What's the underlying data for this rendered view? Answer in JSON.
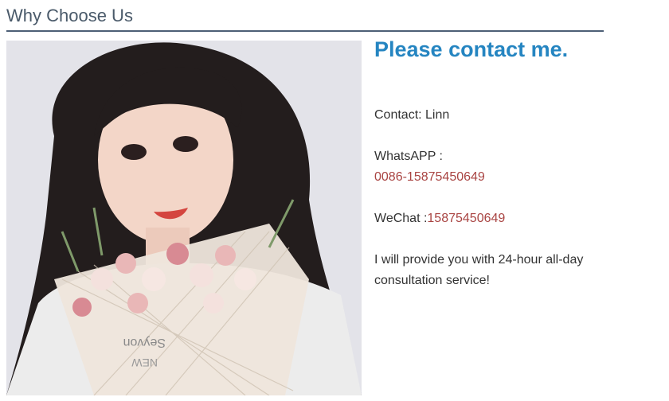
{
  "section": {
    "title": "Why Choose Us"
  },
  "photo": {
    "icon": "portrait-photo",
    "carton_text_1": "Seyvon",
    "carton_text_2": "NEW"
  },
  "contact": {
    "heading": "Please contact me.",
    "contact_label": "Contact: Linn",
    "whatsapp_label": "WhatsAPP :",
    "whatsapp_number": "0086-15875450649",
    "wechat_label": "WeChat :",
    "wechat_number": "15875450649",
    "service_text": "I will provide you with 24-hour all-day consultation service!"
  },
  "colors": {
    "heading": "#2585c1",
    "accent_red": "#a94442",
    "rule": "#4d5f76"
  }
}
